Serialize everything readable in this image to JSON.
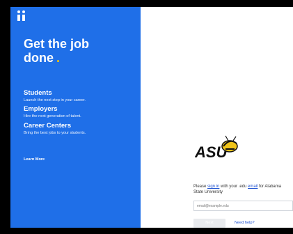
{
  "left_panel": {
    "headline": "Get the job done",
    "headline_accent": ".",
    "sections": [
      {
        "title": "Students",
        "text": "Launch the next step in your career."
      },
      {
        "title": "Employers",
        "text": "Hire the next generation of talent."
      },
      {
        "title": "Career Centers",
        "text": "Bring the best jobs to your students."
      }
    ],
    "learn_more": "Learn More"
  },
  "right_panel": {
    "logo_text": "ASU",
    "note_prefix": "Please ",
    "sign_in_link": "sign in",
    "note_middle": " with your .edu ",
    "email_link": "email",
    "note_suffix": " for Alabama State University",
    "email_placeholder": "email@example.edu",
    "next_button": "Next",
    "need_help": "Need help?"
  },
  "colors": {
    "panel_blue": "#1f6fe8",
    "accent_yellow": "#f6c400",
    "link_blue": "#1a4fd0"
  }
}
